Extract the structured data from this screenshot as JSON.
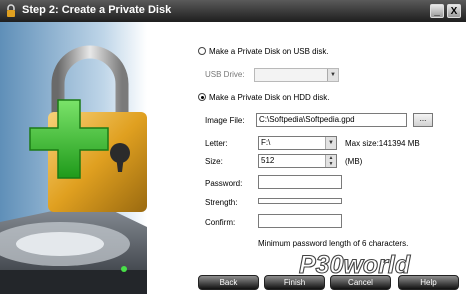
{
  "window": {
    "title": "Step 2: Create a Private Disk"
  },
  "titlebar": {
    "minimize_label": "_",
    "close_label": "X"
  },
  "form": {
    "usb_option_label": "Make a Private Disk on USB disk.",
    "usb_drive_label": "USB Drive:",
    "usb_drive_value": "",
    "hdd_option_label": "Make a Private Disk on HDD disk.",
    "image_file_label": "Image File:",
    "image_file_value": "C:\\Softpedia\\Softpedia.gpd",
    "browse_label": "...",
    "letter_label": "Letter:",
    "letter_value": "F:\\",
    "max_size_text": "Max size:141394 MB",
    "size_label": "Size:",
    "size_value": "512",
    "size_unit": "(MB)",
    "password_label": "Password:",
    "strength_label": "Strength:",
    "confirm_label": "Confirm:",
    "hint_text": "Minimum password length of 6 characters."
  },
  "buttons": {
    "back": "Back",
    "finish": "Finish",
    "cancel": "Cancel",
    "help": "Help"
  },
  "watermark": {
    "text": "P30world"
  },
  "colors": {
    "title_bg": "#2a2a2a",
    "plus_green": "#32cd32",
    "lock_gold": "#e0a020"
  },
  "icons": [
    "lock-icon",
    "plus-icon",
    "hard-disk-icon"
  ]
}
